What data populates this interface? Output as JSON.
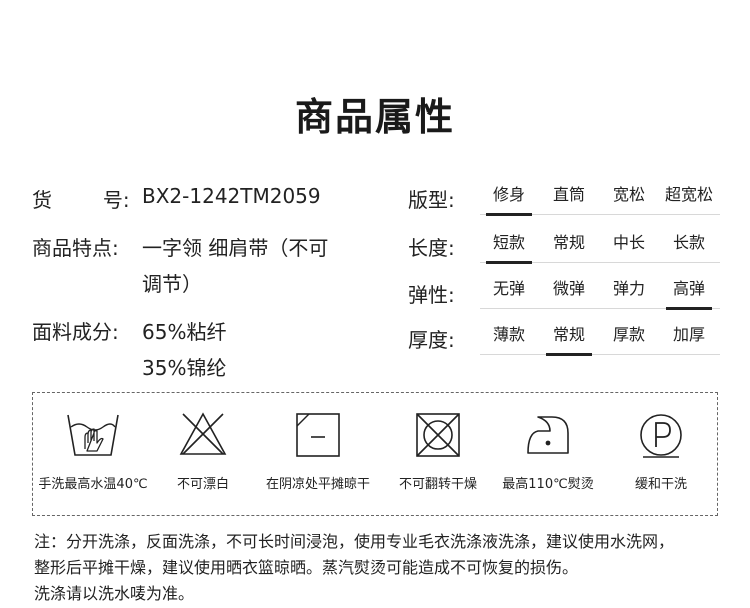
{
  "title": "商品属性",
  "attributes": [
    {
      "label": "货        号:",
      "value_lines": [
        "BX2-1242TM2059"
      ]
    },
    {
      "label": "商品特点:",
      "value_lines": [
        "一字领 细肩带（不可",
        "调节）"
      ]
    },
    {
      "label": "面料成分:",
      "value_lines": [
        "65%粘纤",
        "35%锦纶"
      ]
    }
  ],
  "option_groups": [
    {
      "label": "版型:",
      "options": [
        "修身",
        "直筒",
        "宽松",
        "超宽松"
      ],
      "selected": 0
    },
    {
      "label": "长度:",
      "options": [
        "短款",
        "常规",
        "中长",
        "长款"
      ],
      "selected": 0
    },
    {
      "label": "弹性:",
      "options": [
        "无弹",
        "微弹",
        "弹力",
        "高弹"
      ],
      "selected": 3
    },
    {
      "label": "厚度:",
      "options": [
        "薄款",
        "常规",
        "厚款",
        "加厚"
      ],
      "selected": 1
    }
  ],
  "care": [
    {
      "icon": "hand-wash-icon",
      "label": "手洗最高水温40℃"
    },
    {
      "icon": "no-bleach-icon",
      "label": "不可漂白"
    },
    {
      "icon": "shade-dry-flat-icon",
      "label": "在阴凉处平摊晾干"
    },
    {
      "icon": "no-tumble-dry-icon",
      "label": "不可翻转干燥"
    },
    {
      "icon": "iron-110-icon",
      "label": "最高110℃熨烫"
    },
    {
      "icon": "gentle-dry-clean-icon",
      "label": "缓和干洗"
    }
  ],
  "notes": [
    "注：分开洗涤，反面洗涤，不可长时间浸泡，使用专业毛衣洗涤液洗涤，建议使用水洗网，",
    "整形后平摊干燥，建议使用晒衣篮晾晒。蒸汽熨烫可能造成不可恢复的损伤。",
    "洗涤请以洗水唛为准。"
  ]
}
